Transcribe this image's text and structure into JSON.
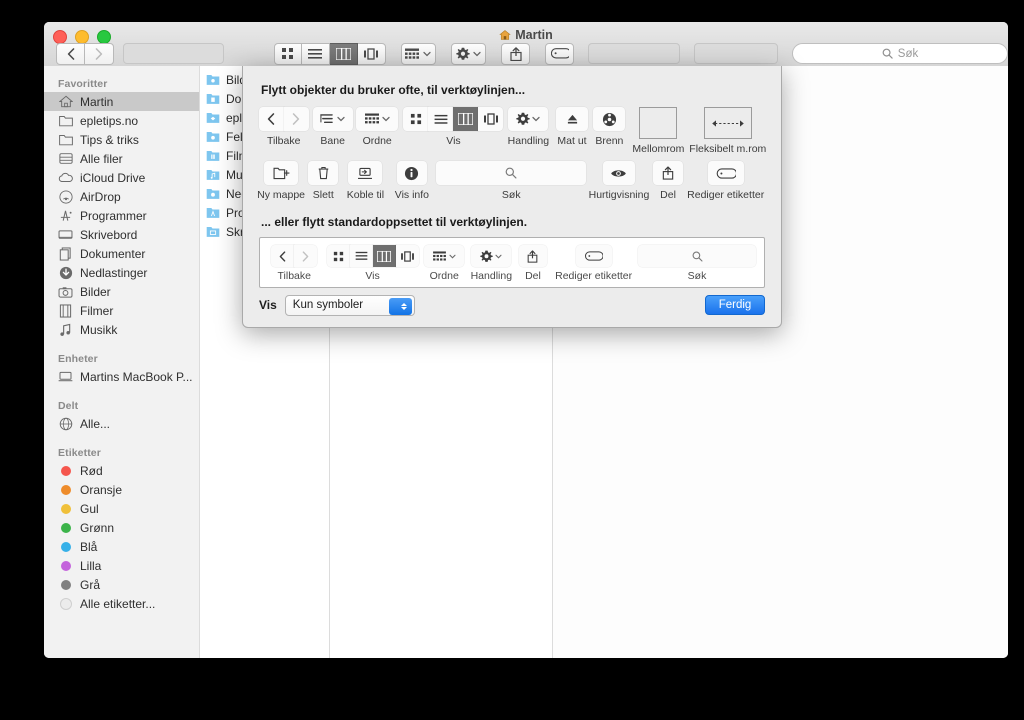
{
  "window": {
    "title": "Martin",
    "title_icon": "home-icon",
    "traffic_lights": [
      "close-red",
      "minimize-yellow",
      "zoom-green"
    ]
  },
  "toolbar": {
    "back_icon": "chevron-left-icon",
    "forward_icon": "chevron-right-icon",
    "view_icon_grid": "icon-view-icon",
    "view_icon_list": "list-view-icon",
    "view_icon_column": "column-view-icon",
    "view_icon_coverflow": "coverflow-view-icon",
    "arrange_icon": "arrange-icon",
    "action_icon": "gear-icon",
    "share_icon": "share-icon",
    "tag_icon": "tag-icon",
    "search_placeholder": "Søk",
    "search_icon": "search-icon"
  },
  "sidebar": {
    "sections": [
      {
        "header": "Favoritter",
        "items": [
          {
            "label": "Martin",
            "icon": "home-icon",
            "selected": true
          },
          {
            "label": "epletips.no",
            "icon": "folder-icon",
            "selected": false
          },
          {
            "label": "Tips & triks",
            "icon": "folder-icon",
            "selected": false
          },
          {
            "label": "Alle filer",
            "icon": "all-files-icon",
            "selected": false
          },
          {
            "label": "iCloud Drive",
            "icon": "cloud-icon",
            "selected": false
          },
          {
            "label": "AirDrop",
            "icon": "airdrop-icon",
            "selected": false
          },
          {
            "label": "Programmer",
            "icon": "applications-icon",
            "selected": false
          },
          {
            "label": "Skrivebord",
            "icon": "desktop-icon",
            "selected": false
          },
          {
            "label": "Dokumenter",
            "icon": "documents-icon",
            "selected": false
          },
          {
            "label": "Nedlastinger",
            "icon": "downloads-icon",
            "selected": false
          },
          {
            "label": "Bilder",
            "icon": "pictures-icon",
            "selected": false
          },
          {
            "label": "Filmer",
            "icon": "movies-icon",
            "selected": false
          },
          {
            "label": "Musikk",
            "icon": "music-icon",
            "selected": false
          }
        ]
      },
      {
        "header": "Enheter",
        "items": [
          {
            "label": "Martins MacBook P...",
            "icon": "laptop-icon",
            "selected": false
          }
        ]
      },
      {
        "header": "Delt",
        "items": [
          {
            "label": "Alle...",
            "icon": "network-globe-icon",
            "selected": false
          }
        ]
      },
      {
        "header": "Etiketter",
        "items": [
          {
            "label": "Rød",
            "icon": "color-dot-icon",
            "color": "#f5564d",
            "selected": false
          },
          {
            "label": "Oransje",
            "icon": "color-dot-icon",
            "color": "#ee8c2b",
            "selected": false
          },
          {
            "label": "Gul",
            "icon": "color-dot-icon",
            "color": "#f0c03a",
            "selected": false
          },
          {
            "label": "Grønn",
            "icon": "color-dot-icon",
            "color": "#3cb44a",
            "selected": false
          },
          {
            "label": "Blå",
            "icon": "color-dot-icon",
            "color": "#36b0e8",
            "selected": false
          },
          {
            "label": "Lilla",
            "icon": "color-dot-icon",
            "color": "#c464dc",
            "selected": false
          },
          {
            "label": "Grå",
            "icon": "color-dot-icon",
            "color": "#808080",
            "selected": false
          },
          {
            "label": "Alle etiketter...",
            "icon": "color-dot-hollow-icon",
            "color": "",
            "selected": false
          }
        ]
      }
    ]
  },
  "file_list": [
    {
      "label": "Bilde",
      "icon": "pictures-folder-icon"
    },
    {
      "label": "Doku",
      "icon": "documents-folder-icon"
    },
    {
      "label": "eplet",
      "icon": "dropbox-folder-icon"
    },
    {
      "label": "Felle",
      "icon": "public-folder-icon"
    },
    {
      "label": "Filme",
      "icon": "movies-folder-icon"
    },
    {
      "label": "Musi",
      "icon": "music-folder-icon"
    },
    {
      "label": "Nedl",
      "icon": "downloads-folder-icon"
    },
    {
      "label": "Prog",
      "icon": "applications-folder-icon"
    },
    {
      "label": "Skriv",
      "icon": "desktop-folder-icon"
    }
  ],
  "sheet": {
    "heading_top": "Flytt objekter du bruker ofte, til verktøylinjen...",
    "heading_default": "... eller flytt standardoppsettet til verktøylinjen.",
    "palette_row1": [
      {
        "label": "Tilbake",
        "icon": "back-forward-segment-icon",
        "kind": "segment-navigation"
      },
      {
        "label": "Bane",
        "icon": "path-dropdown-icon",
        "kind": "dropdown"
      },
      {
        "label": "Ordne",
        "icon": "arrange-dropdown-icon",
        "kind": "dropdown"
      },
      {
        "label": "Vis",
        "icon": "view-mode-segment-icon",
        "kind": "segment-view"
      },
      {
        "label": "Handling",
        "icon": "gear-dropdown-icon",
        "kind": "dropdown"
      },
      {
        "label": "Mat ut",
        "icon": "eject-icon",
        "kind": "button"
      },
      {
        "label": "Brenn",
        "icon": "burn-icon",
        "kind": "button"
      },
      {
        "label": "Mellomrom",
        "icon": "space-box-icon",
        "kind": "spacer"
      },
      {
        "label": "Fleksibelt m.rom",
        "icon": "flexible-space-icon",
        "kind": "flexible-spacer"
      }
    ],
    "palette_row2": [
      {
        "label": "Ny mappe",
        "icon": "new-folder-icon",
        "kind": "button"
      },
      {
        "label": "Slett",
        "icon": "trash-icon",
        "kind": "button"
      },
      {
        "label": "Koble til",
        "icon": "connect-server-icon",
        "kind": "button"
      },
      {
        "label": "Vis info",
        "icon": "info-icon",
        "kind": "button"
      },
      {
        "label": "Søk",
        "icon": "search-icon",
        "kind": "searchfield"
      },
      {
        "label": "Hurtigvisning",
        "icon": "eye-icon",
        "kind": "button"
      },
      {
        "label": "Del",
        "icon": "share-icon",
        "kind": "button"
      },
      {
        "label": "Rediger etiketter",
        "icon": "tag-icon",
        "kind": "button"
      }
    ],
    "default_set": [
      {
        "label": "Tilbake",
        "icon": "back-forward-segment-icon",
        "kind": "segment-navigation"
      },
      {
        "label": "Vis",
        "icon": "view-mode-segment-icon",
        "kind": "segment-view"
      },
      {
        "label": "Ordne",
        "icon": "arrange-dropdown-icon",
        "kind": "dropdown"
      },
      {
        "label": "Handling",
        "icon": "gear-dropdown-icon",
        "kind": "dropdown"
      },
      {
        "label": "Del",
        "icon": "share-icon",
        "kind": "button"
      },
      {
        "label": "Rediger etiketter",
        "icon": "tag-icon",
        "kind": "button"
      },
      {
        "label": "Søk",
        "icon": "search-icon",
        "kind": "searchfield"
      }
    ],
    "footer": {
      "vis_label": "Vis",
      "popup_value": "Kun symboler",
      "popup_icon": "updown-arrows-icon",
      "done_label": "Ferdig"
    }
  }
}
